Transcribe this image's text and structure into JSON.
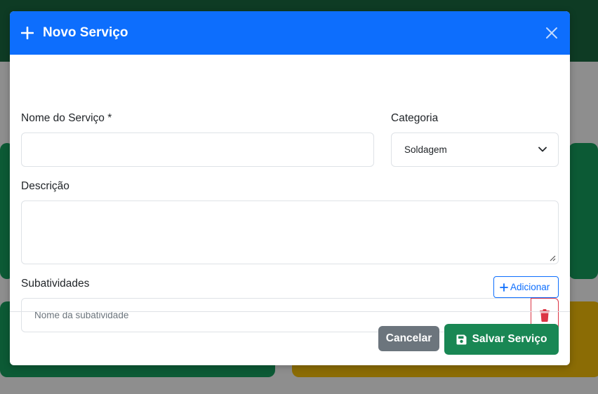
{
  "modal": {
    "title": "Novo Serviço",
    "header_color": "#0d6efd"
  },
  "form": {
    "name_label": "Nome do Serviço *",
    "name_value": "",
    "category_label": "Categoria",
    "category_selected": "Soldagem",
    "description_label": "Descrição",
    "description_value": "",
    "subactivities_label": "Subatividades",
    "add_label": "Adicionar",
    "subactivity_placeholder": "Nome da subatividade"
  },
  "footer": {
    "cancel_label": "Cancelar",
    "save_label": "Salvar Serviço",
    "save_color": "#198754",
    "cancel_color": "#6c757d"
  },
  "icons": [
    "plus-icon",
    "close-icon",
    "chevron-down-icon",
    "plus-icon",
    "trash-icon",
    "floppy-disk-icon"
  ]
}
